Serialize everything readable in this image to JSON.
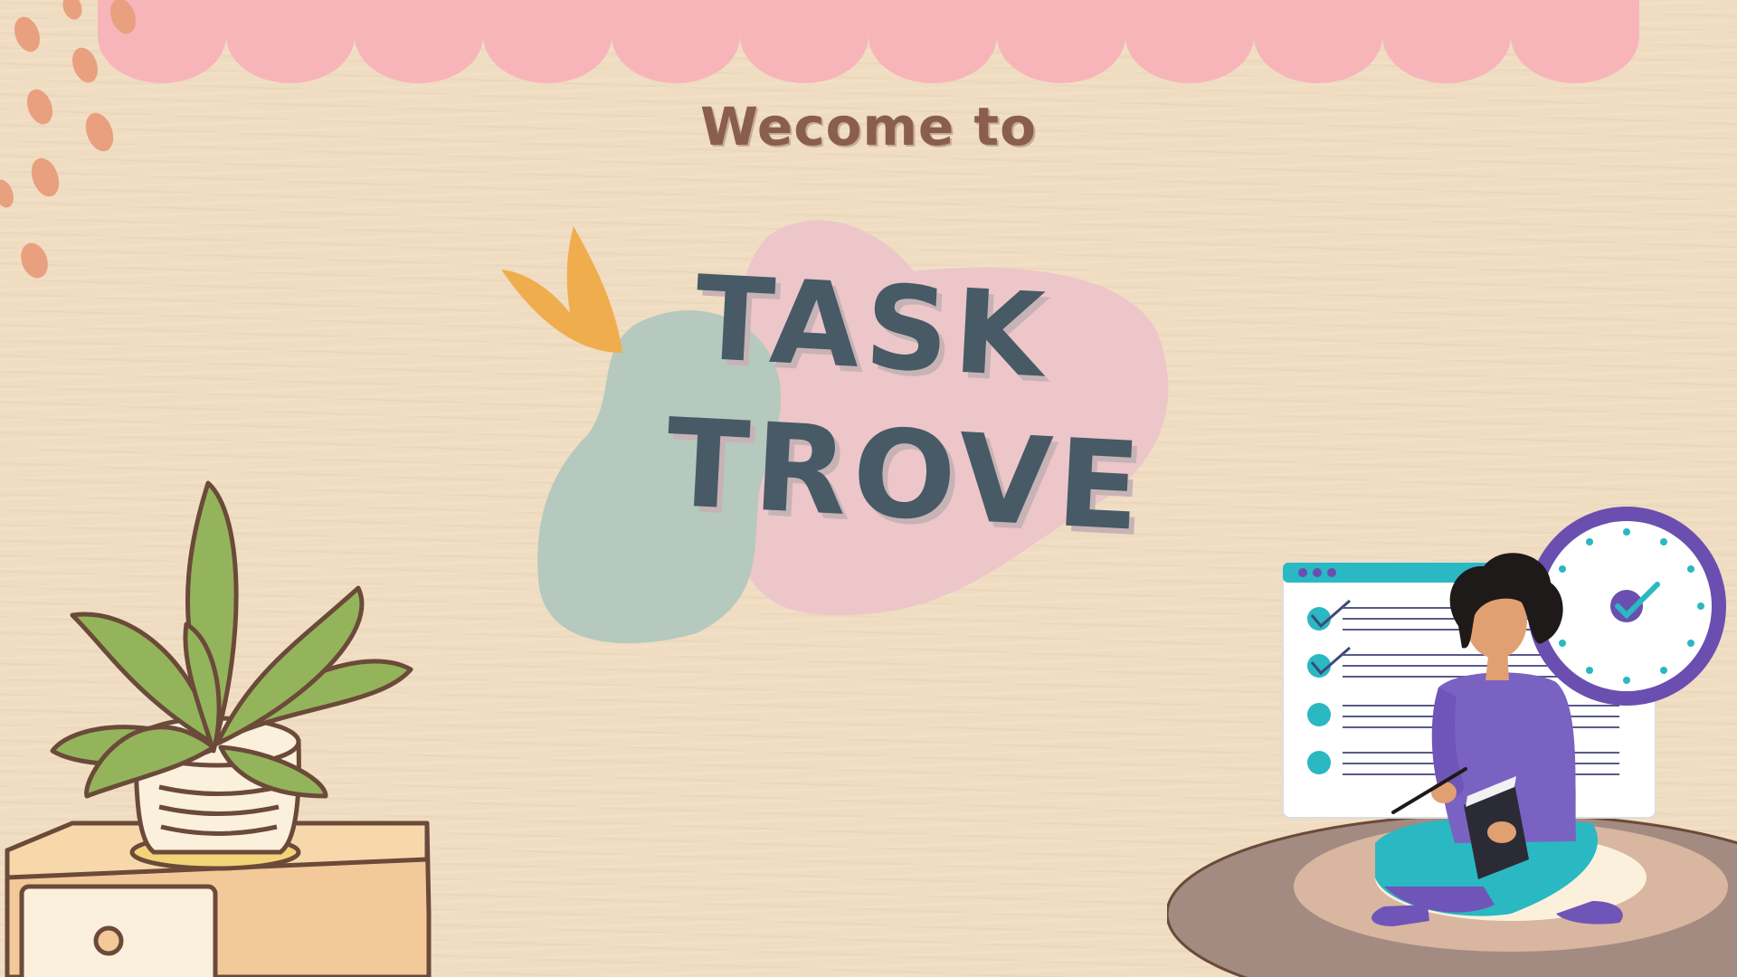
{
  "slide": {
    "welcome_text": "Wecome to",
    "title_line_1": "TASK",
    "title_line_2": "TROVE"
  },
  "colors": {
    "background": "#efdcc1",
    "scallop": "#f7b5b9",
    "dots": "#e8a07e",
    "welcome_text": "#8a5e4e",
    "title_text": "#475a66",
    "blob_green": "#b5c9be",
    "blob_pink": "#ecc6c9",
    "leaf_accent": "#f0ad4e",
    "checklist_teal": "#2ab8c2",
    "clock_purple": "#6a4fb0"
  },
  "icons": {
    "banner": "scallop-banner-icon",
    "dots": "decorative-dots-icon",
    "leaf": "leaf-accent-icon",
    "plant": "potted-plant-icon",
    "nightstand": "nightstand-icon",
    "checklist": "checklist-icon",
    "clock": "clock-icon",
    "person": "person-writing-icon",
    "rug": "rug-icon"
  }
}
